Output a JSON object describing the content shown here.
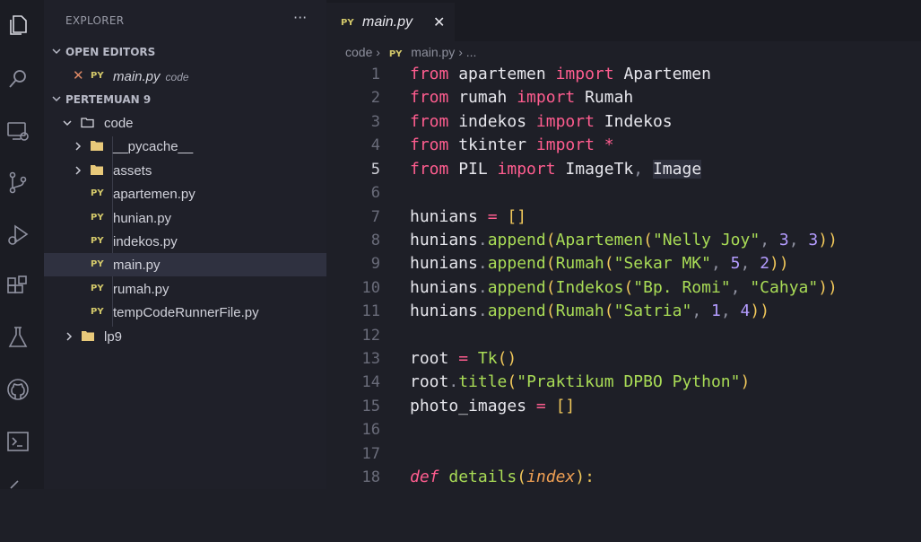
{
  "sidebar": {
    "header": "EXPLORER",
    "more": "···",
    "open_editors_label": "OPEN EDITORS",
    "open_editor_file": "main.py",
    "open_editor_folder": "code",
    "project_label": "PERTEMUAN 9",
    "tree": [
      {
        "name": "code",
        "kind": "folder-open"
      },
      {
        "name": "__pycache__",
        "kind": "folder"
      },
      {
        "name": "assets",
        "kind": "folder"
      },
      {
        "name": "apartemen.py",
        "kind": "file"
      },
      {
        "name": "hunian.py",
        "kind": "file"
      },
      {
        "name": "indekos.py",
        "kind": "file"
      },
      {
        "name": "main.py",
        "kind": "file",
        "selected": true
      },
      {
        "name": "rumah.py",
        "kind": "file"
      },
      {
        "name": "tempCodeRunnerFile.py",
        "kind": "file"
      },
      {
        "name": "lp9",
        "kind": "folder"
      }
    ],
    "py_badge": "PY"
  },
  "editor": {
    "tab_name": "main.py",
    "tab_close": "✕",
    "breadcrumb_folder": "code",
    "breadcrumb_file": "main.py",
    "breadcrumb_tail": "...",
    "line_numbers": [
      "1",
      "2",
      "3",
      "4",
      "5",
      "6",
      "7",
      "8",
      "9",
      "10",
      "11",
      "12",
      "13",
      "14",
      "15",
      "16",
      "17",
      "18"
    ]
  },
  "code": {
    "l1": {
      "a": "from",
      "b": " apartemen ",
      "c": "import",
      "d": " Apartemen"
    },
    "l2": {
      "a": "from",
      "b": " rumah ",
      "c": "import",
      "d": " Rumah"
    },
    "l3": {
      "a": "from",
      "b": " indekos ",
      "c": "import",
      "d": " Indekos"
    },
    "l4": {
      "a": "from",
      "b": " tkinter ",
      "c": "import",
      "d": " *"
    },
    "l5": {
      "a": "from",
      "b": " PIL ",
      "c": "import",
      "d": " ImageTk",
      "e": ", ",
      "f": "Image"
    },
    "l7": {
      "a": "hunians ",
      "b": "=",
      "c": " []"
    },
    "l8": {
      "a": "hunians",
      "b": ".",
      "c": "append",
      "d": "(",
      "e": "Apartemen",
      "f": "(",
      "g": "\"Nelly Joy\"",
      "h": ", ",
      "i": "3",
      "j": ", ",
      "k": "3",
      "l": "))"
    },
    "l9": {
      "a": "hunians",
      "b": ".",
      "c": "append",
      "d": "(",
      "e": "Rumah",
      "f": "(",
      "g": "\"Sekar MK\"",
      "h": ", ",
      "i": "5",
      "j": ", ",
      "k": "2",
      "l": "))"
    },
    "l10": {
      "a": "hunians",
      "b": ".",
      "c": "append",
      "d": "(",
      "e": "Indekos",
      "f": "(",
      "g": "\"Bp. Romi\"",
      "h": ", ",
      "i": "\"Cahya\"",
      "l": "))"
    },
    "l11": {
      "a": "hunians",
      "b": ".",
      "c": "append",
      "d": "(",
      "e": "Rumah",
      "f": "(",
      "g": "\"Satria\"",
      "h": ", ",
      "i": "1",
      "j": ", ",
      "k": "4",
      "l": "))"
    },
    "l13": {
      "a": "root ",
      "b": "=",
      "c": " ",
      "d": "Tk",
      "e": "()"
    },
    "l14": {
      "a": "root",
      "b": ".",
      "c": "title",
      "d": "(",
      "e": "\"Praktikum DPBO Python\"",
      "f": ")"
    },
    "l15": {
      "a": "photo_images ",
      "b": "=",
      "c": " []"
    },
    "l18": {
      "a": "def",
      "b": " ",
      "c": "details",
      "d": "(",
      "e": "index",
      "f": "):"
    }
  },
  "colors": {
    "keyword": "#ff5d8f",
    "function": "#a9dc56",
    "number": "#b49cff",
    "paren": "#f0c75a",
    "param": "#f0a054",
    "py_badge": "#d3c86a"
  }
}
